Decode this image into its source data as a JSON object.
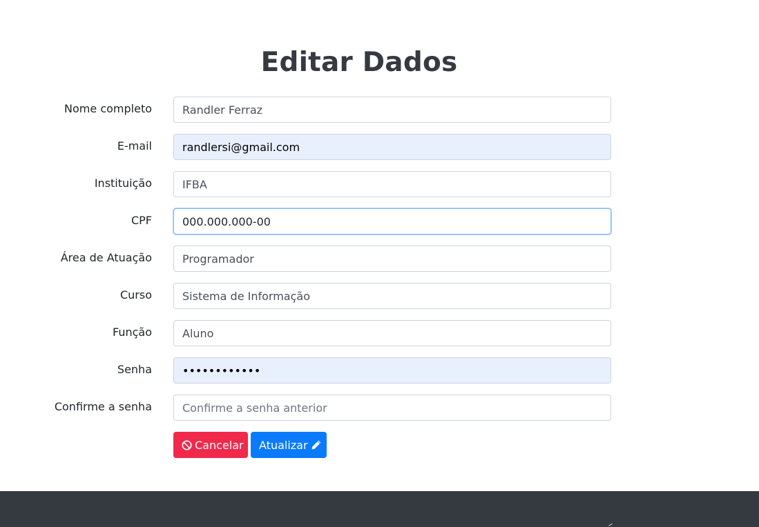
{
  "page": {
    "title": "Editar Dados"
  },
  "form": {
    "fields": [
      {
        "label": "Nome completo",
        "value": "Randler Ferraz",
        "placeholder": ""
      },
      {
        "label": "E-mail",
        "value": "randlersi@gmail.com",
        "placeholder": ""
      },
      {
        "label": "Instituição",
        "value": "IFBA",
        "placeholder": ""
      },
      {
        "label": "CPF",
        "value": "000.000.000-00",
        "placeholder": ""
      },
      {
        "label": "Área de Atuação",
        "value": "Programador",
        "placeholder": ""
      },
      {
        "label": "Curso",
        "value": "Sistema de Informação",
        "placeholder": ""
      },
      {
        "label": "Função",
        "value": "Aluno",
        "placeholder": ""
      },
      {
        "label": "Senha",
        "value": "••••••••••••",
        "placeholder": ""
      },
      {
        "label": "Confirme a senha",
        "value": "",
        "placeholder": "Confirme a senha anterior"
      }
    ]
  },
  "actions": {
    "cancel_label": "Cancelar",
    "cancel_icon": "ban-icon",
    "update_label": "Atualizar",
    "update_icon": "pencil-icon"
  },
  "colors": {
    "cancel": "#f1294a",
    "update": "#0a7bff",
    "autofill": "#e8f0fe",
    "footer": "#353a40"
  }
}
